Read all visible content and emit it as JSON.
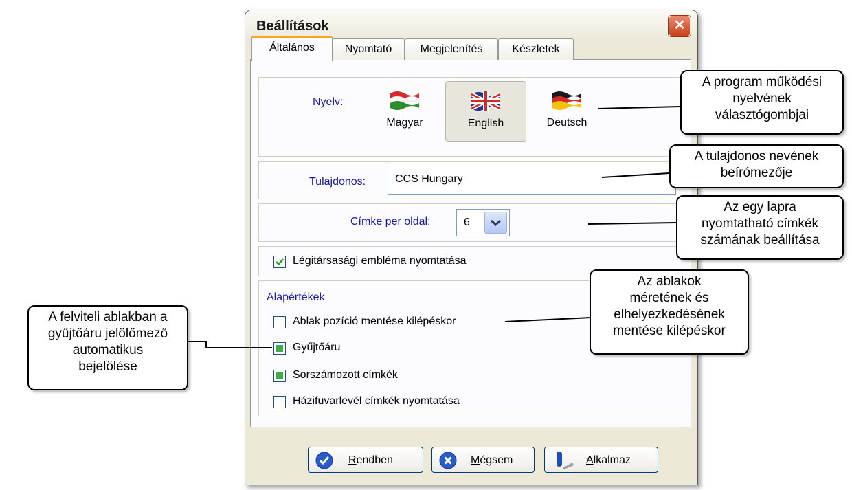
{
  "window": {
    "title": "Beállítások",
    "close_label": "✕"
  },
  "tabs": [
    "Általános",
    "Nyomtató",
    "Megjelenítés",
    "Készletek"
  ],
  "language": {
    "label": "Nyelv:",
    "options": [
      {
        "name": "Magyar",
        "flag": "hungary-flag-icon"
      },
      {
        "name": "English",
        "flag": "uk-flag-icon",
        "selected": true
      },
      {
        "name": "Deutsch",
        "flag": "germany-flag-icon"
      }
    ]
  },
  "owner": {
    "label": "Tulajdonos:",
    "value": "CCS Hungary"
  },
  "labels_per_page": {
    "label": "Címke per oldal:",
    "value": "6"
  },
  "airline_logo": {
    "label": "Légitársasági embléma nyomtatása",
    "checked": true
  },
  "defaults": {
    "title": "Alapértékek",
    "items": [
      {
        "label": "Ablak pozíció mentése kilépéskor",
        "checked": false
      },
      {
        "label": "Gyűjtőáru",
        "checked": true
      },
      {
        "label": "Sorszámozott címkék",
        "checked": true
      },
      {
        "label": "Házifuvarlevél címkék nyomtatása",
        "checked": false
      }
    ]
  },
  "buttons": {
    "ok": {
      "first": "R",
      "rest": "endben"
    },
    "cancel": {
      "first": "M",
      "rest": "égsem"
    },
    "apply": {
      "first": "A",
      "rest": "lkalmaz"
    }
  },
  "callouts": {
    "language": [
      "A program működési",
      "nyelvének",
      "választógombjai"
    ],
    "owner": [
      "A tulajdonos nevének",
      "beírómezője"
    ],
    "labels": [
      "Az egy lapra",
      "nyomtatható címkék",
      "számának beállítása"
    ],
    "window_pos": [
      "Az ablakok",
      "méretének és",
      "elhelyezkedésének",
      "mentése kilépéskor"
    ],
    "consolidated": [
      "A felviteli ablakban a",
      "gyűjtőáru jelölőmező",
      "automatikus",
      "bejelölése"
    ]
  },
  "colors": {
    "accent_tab": "#f5a623",
    "check_green": "#3fac4a",
    "label_blue": "#1a1aa8",
    "close_red": "#c8421c"
  }
}
